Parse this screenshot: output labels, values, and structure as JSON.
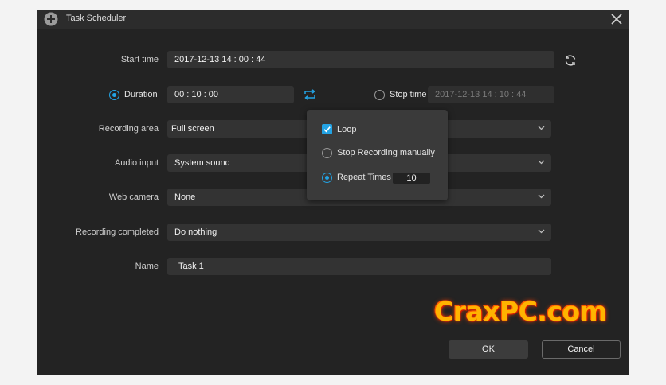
{
  "window": {
    "title": "Task Scheduler",
    "icons": {
      "add": "plus-circle-icon",
      "close": "close-icon"
    }
  },
  "form": {
    "start_time": {
      "label": "Start time",
      "value": "2017-12-13 14 : 00 : 44"
    },
    "duration": {
      "label": "Duration",
      "value": "00 : 10 : 00",
      "selected": true,
      "loop_icon": "loop-icon"
    },
    "stop_time": {
      "label": "Stop time",
      "value": "2017-12-13 14 : 10 : 44",
      "selected": false
    },
    "recording_area": {
      "label": "Recording area",
      "value": "Full screen"
    },
    "audio_input": {
      "label": "Audio input",
      "value": "System sound"
    },
    "web_camera": {
      "label": "Web camera",
      "value": "None"
    },
    "recording_completed": {
      "label": "Recording completed",
      "value": "Do nothing"
    },
    "name": {
      "label": "Name",
      "value": "Task 1"
    }
  },
  "loop_popup": {
    "loop": {
      "label": "Loop",
      "checked": true
    },
    "stop_manually": {
      "label": "Stop Recording manually",
      "selected": false
    },
    "repeat_times": {
      "label": "Repeat Times",
      "selected": true,
      "value": "10"
    }
  },
  "buttons": {
    "ok": "OK",
    "cancel": "Cancel"
  },
  "watermark": "CraxPC.com",
  "colors": {
    "accent": "#23a3e4",
    "window_bg": "#232323",
    "field_bg": "#333333",
    "watermark": "#ffb300"
  }
}
